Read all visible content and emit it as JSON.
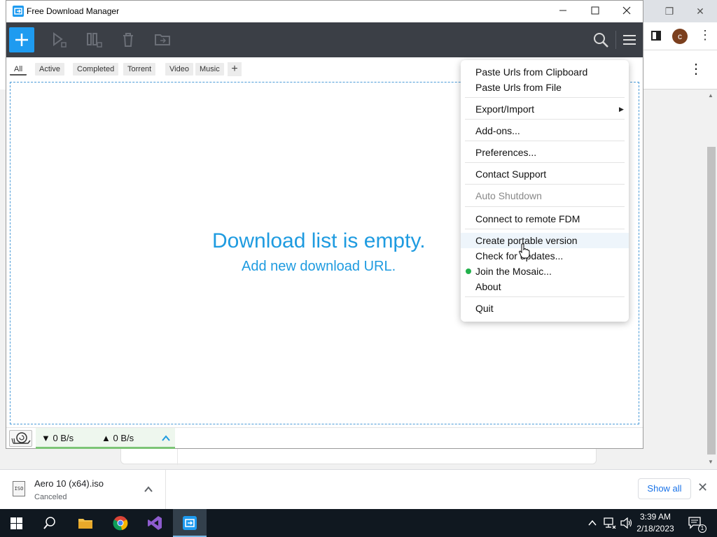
{
  "fdm": {
    "title": "Free Download Manager",
    "tabs": [
      "All",
      "Active",
      "Completed",
      "Torrent",
      "Video",
      "Music"
    ],
    "empty_title": "Download list is empty.",
    "empty_subtitle": "Add new download URL.",
    "speed_down": "▼ 0 B/s",
    "speed_up": "▲ 0 B/s",
    "accent": "#1e9bf0"
  },
  "menu": {
    "items": [
      "Paste Urls from Clipboard",
      "Paste Urls from File",
      "Export/Import",
      "Add-ons...",
      "Preferences...",
      "Contact Support",
      "Auto Shutdown",
      "Connect to remote FDM",
      "Create portable version",
      "Check for updates...",
      "Join the Mosaic...",
      "About",
      "Quit"
    ]
  },
  "chrome": {
    "avatar_letter": "c",
    "download": {
      "file_name": "Aero 10 (x64).iso",
      "status": "Canceled",
      "file_icon_label": "ISO"
    },
    "show_all": "Show all"
  },
  "taskbar": {
    "time": "3:39 AM",
    "date": "2/18/2023",
    "notification_count": "1"
  }
}
